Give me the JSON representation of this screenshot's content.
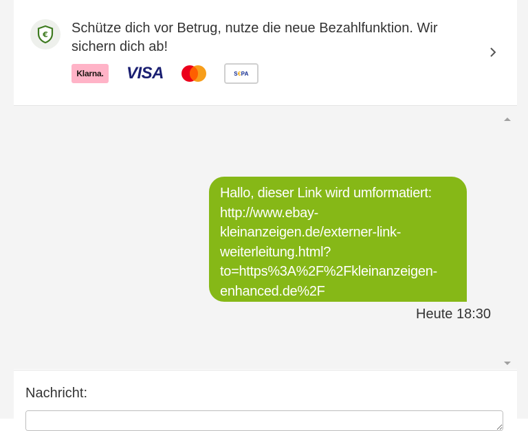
{
  "banner": {
    "text": "Schütze dich vor Betrug, nutze die neue Bezahlfunktion. Wir sichern dich ab!",
    "logos": {
      "klarna": "Klarna.",
      "visa": "VISA",
      "sepa_prefix": "S",
      "sepa_accent": "€",
      "sepa_suffix": "PA"
    },
    "icon": "shield-euro-icon",
    "accent_color": "#3d7a1f"
  },
  "chat": {
    "messages": [
      {
        "direction": "outgoing",
        "text": "Hallo, dieser Link wird umformatiert:\nhttp://www.ebay-\nkleinanzeigen.de/externer-link-\nweiterleitung.html?\nto=https%3A%2F%2Fkleinanzeigen-\nenhanced.de%2F",
        "time": "Heute 18:30",
        "bubble_color": "#86b817"
      }
    ]
  },
  "composer": {
    "label": "Nachricht:",
    "value": ""
  }
}
